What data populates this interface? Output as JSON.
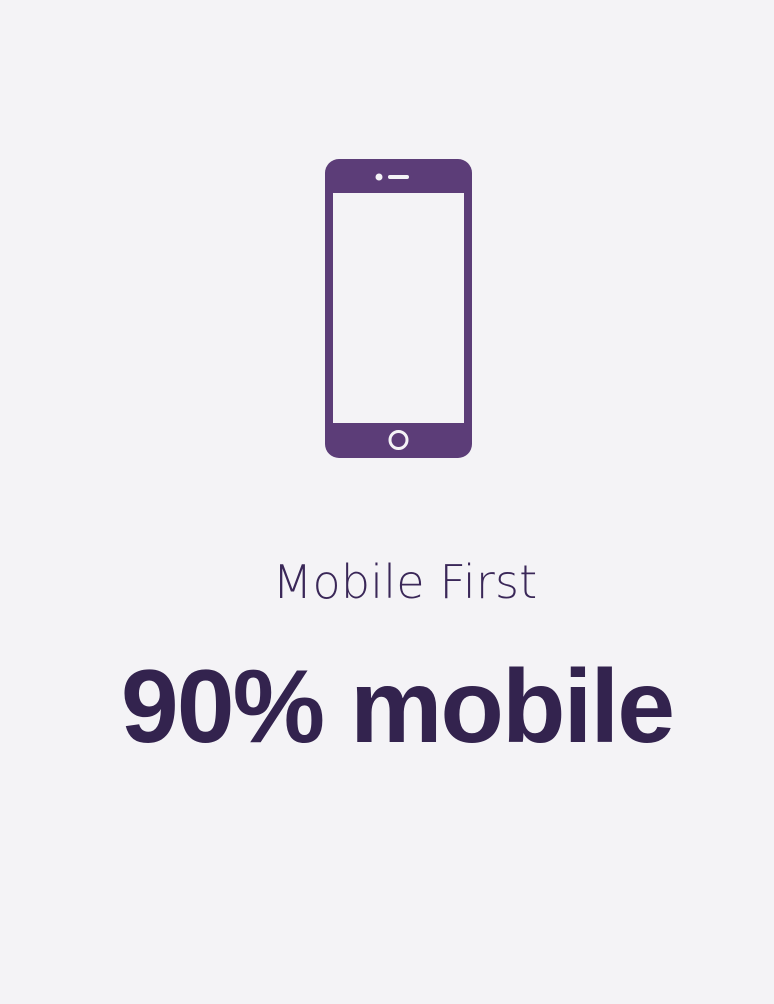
{
  "icon": {
    "name": "smartphone-icon",
    "color": "#5c3d78"
  },
  "subtitle": "Mobile First",
  "headline": "90% mobile",
  "colors": {
    "background": "#f4f3f6",
    "text": "#33234e"
  }
}
